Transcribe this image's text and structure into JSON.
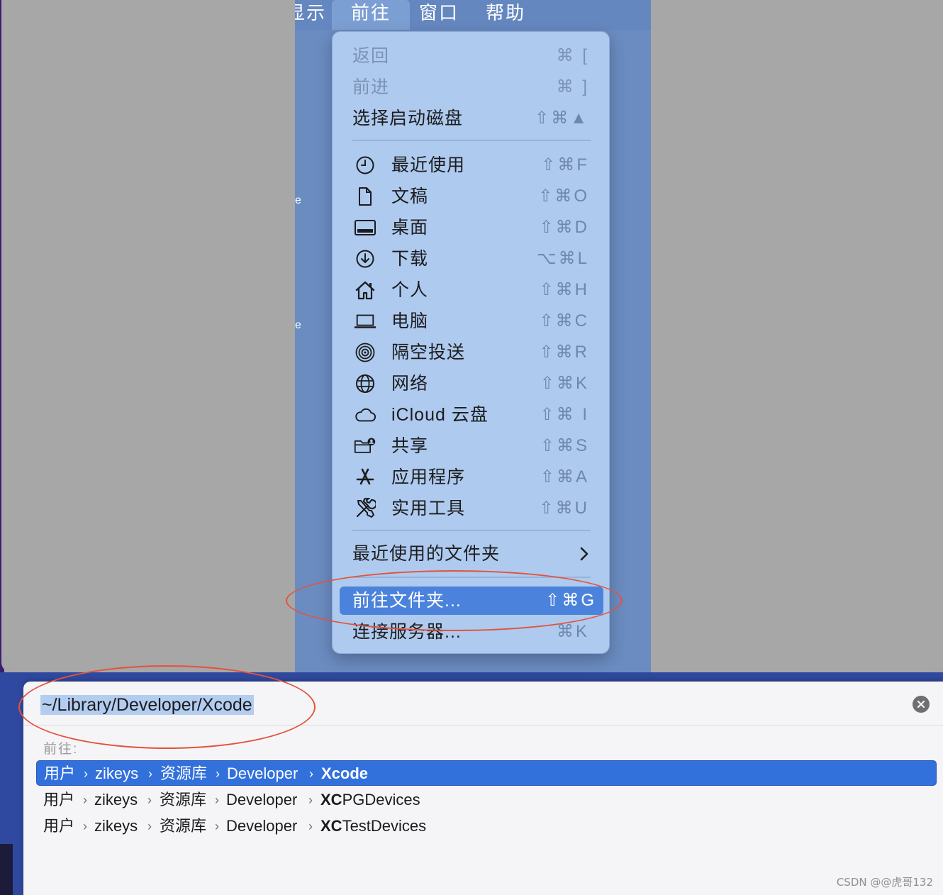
{
  "menubar": {
    "items": [
      "显示",
      "前往",
      "窗口",
      "帮助"
    ]
  },
  "go_menu": {
    "group1": [
      {
        "label": "返回",
        "shortcut": "⌘ [",
        "enabled": false
      },
      {
        "label": "前进",
        "shortcut": "⌘ ]",
        "enabled": false
      },
      {
        "label": "选择启动磁盘",
        "shortcut": "⇧⌘▲",
        "enabled": true
      }
    ],
    "group2": [
      {
        "label": "最近使用",
        "shortcut": "⇧⌘F",
        "icon": "clock-icon"
      },
      {
        "label": "文稿",
        "shortcut": "⇧⌘O",
        "icon": "document-icon"
      },
      {
        "label": "桌面",
        "shortcut": "⇧⌘D",
        "icon": "desktop-icon"
      },
      {
        "label": "下载",
        "shortcut": "⌥⌘L",
        "icon": "download-icon"
      },
      {
        "label": "个人",
        "shortcut": "⇧⌘H",
        "icon": "home-icon"
      },
      {
        "label": "电脑",
        "shortcut": "⇧⌘C",
        "icon": "laptop-icon"
      },
      {
        "label": "隔空投送",
        "shortcut": "⇧⌘R",
        "icon": "airdrop-icon"
      },
      {
        "label": "网络",
        "shortcut": "⇧⌘K",
        "icon": "globe-icon"
      },
      {
        "label": "iCloud 云盘",
        "shortcut": "⇧⌘ I",
        "icon": "cloud-icon"
      },
      {
        "label": "共享",
        "shortcut": "⇧⌘S",
        "icon": "shared-folder-icon"
      },
      {
        "label": "应用程序",
        "shortcut": "⇧⌘A",
        "icon": "applications-icon"
      },
      {
        "label": "实用工具",
        "shortcut": "⇧⌘U",
        "icon": "utilities-icon"
      }
    ],
    "recent_folders": "最近使用的文件夹",
    "goto_folder": {
      "label": "前往文件夹...",
      "shortcut": "⇧⌘G"
    },
    "connect_server": {
      "label": "连接服务器...",
      "shortcut": "⌘K"
    }
  },
  "goto_panel": {
    "path_value": "~/Library/Developer/Xcode",
    "goto_label": "前往:",
    "suggestions": [
      {
        "segments": [
          "用户",
          "zikeys",
          "资源库",
          "Developer"
        ],
        "last_bold": "Xcode",
        "last_rest": "",
        "selected": true
      },
      {
        "segments": [
          "用户",
          "zikeys",
          "资源库",
          "Developer"
        ],
        "last_bold": "XC",
        "last_rest": "PGDevices",
        "selected": false
      },
      {
        "segments": [
          "用户",
          "zikeys",
          "资源库",
          "Developer"
        ],
        "last_bold": "XC",
        "last_rest": "TestDevices",
        "selected": false
      }
    ]
  },
  "watermark": "CSDN @@虎哥132",
  "colors": {
    "menu_bg": "#aecaee",
    "highlight": "#4b83dc",
    "selection": "#3270dc",
    "annotation": "#e4523b"
  }
}
